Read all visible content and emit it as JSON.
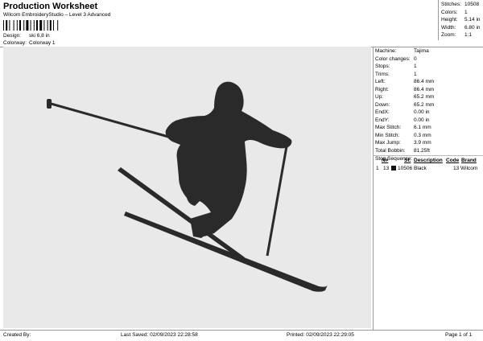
{
  "header": {
    "title": "Production Worksheet",
    "subtitle": "Wilcom EmbroideryStudio – Level 3 Advanced",
    "design_label": "Design:",
    "design_value": "ski 6,8 in",
    "colorway_label": "Colorway:",
    "colorway_value": "Colorway 1"
  },
  "summary": {
    "stitches_label": "Stitches:",
    "stitches_value": "10508",
    "colors_label": "Colors:",
    "colors_value": "1",
    "height_label": "Height:",
    "height_value": "5.14 in",
    "width_label": "Width:",
    "width_value": "6.80 in",
    "zoom_label": "Zoom:",
    "zoom_value": "1:1"
  },
  "machine_info": [
    {
      "label": "Machine:",
      "value": "Tajima"
    },
    {
      "label": "Color changes:",
      "value": "0"
    },
    {
      "label": "Stops:",
      "value": "1"
    },
    {
      "label": "Trims:",
      "value": "1"
    },
    {
      "label": "Left:",
      "value": "86.4 mm"
    },
    {
      "label": "Right:",
      "value": "86.4 mm"
    },
    {
      "label": "Up:",
      "value": "65.2 mm"
    },
    {
      "label": "Down:",
      "value": "65.2 mm"
    },
    {
      "label": "EndX:",
      "value": "0.00 in"
    },
    {
      "label": "EndY:",
      "value": "0.00 in"
    },
    {
      "label": "Max Stitch:",
      "value": "6.1 mm"
    },
    {
      "label": "Min Stitch:",
      "value": "0.3 mm"
    },
    {
      "label": "Max Jump:",
      "value": "3.9 mm"
    },
    {
      "label": "Total Bobbin:",
      "value": "81.25ft"
    }
  ],
  "stop_sequence": {
    "title": "Stop Sequence:",
    "headers": {
      "n": "N#",
      "st": "St.",
      "description": "Description",
      "code": "Code",
      "brand": "Brand"
    },
    "rows": [
      {
        "index": "1",
        "n": "13",
        "st": "10506",
        "description": "Black",
        "code": "13",
        "brand": "Wilcom",
        "swatch": "#111111"
      }
    ]
  },
  "footer": {
    "created_by": "Created By:",
    "last_saved": "Last Saved: 02/09/2023 22:28:58",
    "printed": "Printed: 02/09/2023 22:29:05",
    "page": "Page 1 of 1"
  },
  "design_colors": {
    "canvas": "#e9e9e9",
    "thread": "#2a2a2a"
  }
}
